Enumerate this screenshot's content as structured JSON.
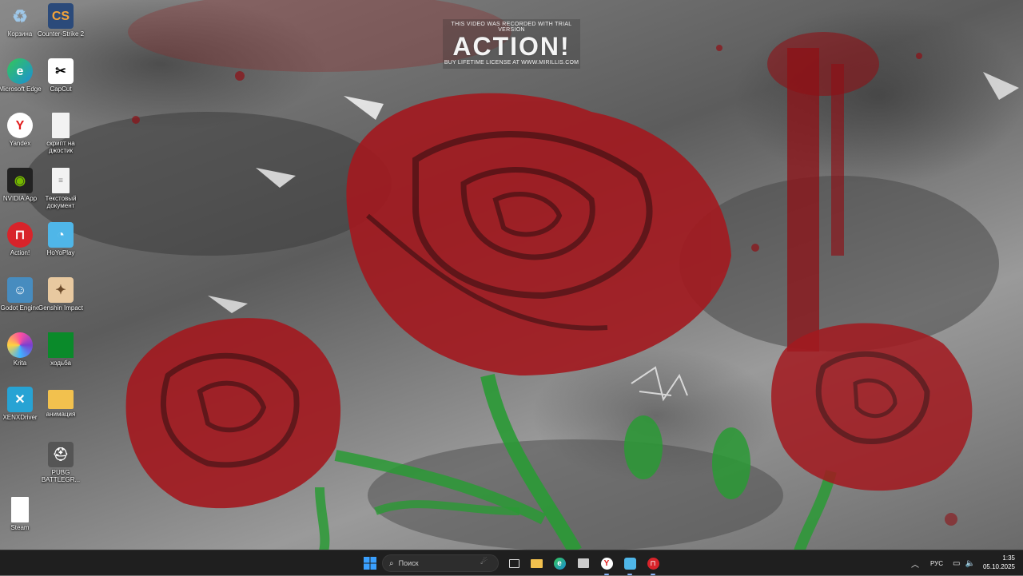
{
  "watermark": {
    "top": "THIS VIDEO WAS RECORDED WITH TRIAL VERSION",
    "logo": "ACTION!",
    "bottom": "BUY LIFETIME LICENSE AT WWW.MIRILLIS.COM"
  },
  "desktop_icons": [
    {
      "label": "Корзина",
      "icon": "recycle-bin-icon",
      "color": "#9ec7e8"
    },
    {
      "label": "Counter-Strike 2",
      "icon": "counter-strike-icon",
      "color": "#2b4a7a"
    },
    {
      "label": "Microsoft Edge",
      "icon": "edge-icon",
      "color": "#1b8fd6"
    },
    {
      "label": "CapCut",
      "icon": "capcut-icon",
      "color": "#ffffff"
    },
    {
      "label": "Yandex",
      "icon": "yandex-icon",
      "color": "#ffffff"
    },
    {
      "label": "скрипт на джостик",
      "icon": "text-file-icon",
      "color": "#f2f2f2"
    },
    {
      "label": "NVIDIA App",
      "icon": "nvidia-icon",
      "color": "#222222"
    },
    {
      "label": "Текстовый документ",
      "icon": "text-document-icon",
      "color": "#f2f2f2"
    },
    {
      "label": "Action!",
      "icon": "action-icon",
      "color": "#d8232a"
    },
    {
      "label": "HoYoPlay",
      "icon": "hoyoplay-icon",
      "color": "#4fb6e8"
    },
    {
      "label": "Godot Engine",
      "icon": "godot-icon",
      "color": "#478cbf"
    },
    {
      "label": "Genshin Impact",
      "icon": "genshin-icon",
      "color": "#e8c9a0"
    },
    {
      "label": "Krita",
      "icon": "krita-icon",
      "color": "#7b3fd0"
    },
    {
      "label": "ходьба",
      "icon": "image-file-icon",
      "color": "#0a8a2a"
    },
    {
      "label": "XENXDriver",
      "icon": "xenx-icon",
      "color": "#27a3d4"
    },
    {
      "label": "анимация",
      "icon": "folder-icon",
      "color": "#f2c14e"
    },
    {
      "label": "PUBG BATTLEGR...",
      "icon": "pubg-icon",
      "color": "#555555"
    },
    {
      "label": "Steam",
      "icon": "blank-file-icon",
      "color": "#ffffff"
    }
  ],
  "taskbar": {
    "start_icon": "windows-start-icon",
    "search_placeholder": "Поиск",
    "pinned": [
      {
        "name": "task-view-icon",
        "glyph": "▭",
        "active": false
      },
      {
        "name": "file-explorer-icon",
        "glyph": "📁",
        "active": false
      },
      {
        "name": "edge-icon",
        "glyph": "e",
        "active": false
      },
      {
        "name": "microsoft-store-icon",
        "glyph": "▦",
        "active": false
      },
      {
        "name": "yandex-browser-icon",
        "glyph": "Y",
        "active": true
      },
      {
        "name": "hoyoplay-icon",
        "glyph": "◉",
        "active": true
      },
      {
        "name": "action-recorder-icon",
        "glyph": "⊓",
        "active": true
      }
    ],
    "tray": {
      "language": "РУС",
      "time": "1:35",
      "date": "05.10.2025"
    }
  },
  "colors": {
    "taskbar_bg": "#1f1f1f",
    "accent": "#0078d4",
    "rose_red": "#a3191f",
    "stem_green": "#2a9a35"
  }
}
